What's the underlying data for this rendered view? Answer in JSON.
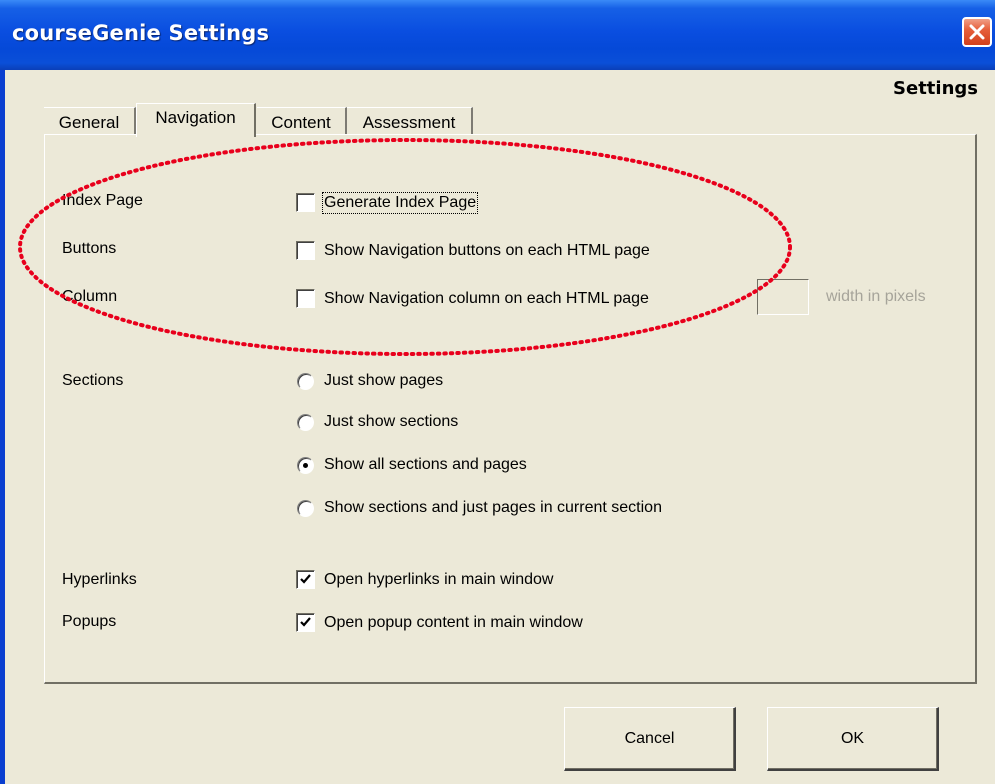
{
  "window": {
    "title": "courseGenie Settings",
    "heading": "Settings"
  },
  "tabs": [
    {
      "label": "General",
      "active": false
    },
    {
      "label": "Navigation",
      "active": true
    },
    {
      "label": "Content",
      "active": false
    },
    {
      "label": "Assessment",
      "active": false
    }
  ],
  "navigation": {
    "index_page": {
      "label": "Index Page",
      "option": "Generate Index Page",
      "checked": false
    },
    "buttons": {
      "label": "Buttons",
      "option": "Show Navigation buttons on each HTML page",
      "checked": false
    },
    "column": {
      "label": "Column",
      "option": "Show Navigation column on each HTML page",
      "checked": false,
      "width_value": "",
      "width_hint": "width in pixels"
    },
    "sections": {
      "label": "Sections",
      "options": [
        {
          "label": "Just show pages",
          "selected": false
        },
        {
          "label": "Just show sections",
          "selected": false
        },
        {
          "label": "Show all sections and pages",
          "selected": true
        },
        {
          "label": "Show sections and just pages in current section",
          "selected": false
        }
      ]
    },
    "hyperlinks": {
      "label": "Hyperlinks",
      "option": "Open hyperlinks in main window",
      "checked": true
    },
    "popups": {
      "label": "Popups",
      "option": "Open popup content in main window",
      "checked": true
    }
  },
  "buttons": {
    "cancel": "Cancel",
    "ok": "OK"
  },
  "colors": {
    "titlebar": "#0a4ee0",
    "annotation": "#e8001c",
    "dialog_bg": "#ece9d8"
  }
}
